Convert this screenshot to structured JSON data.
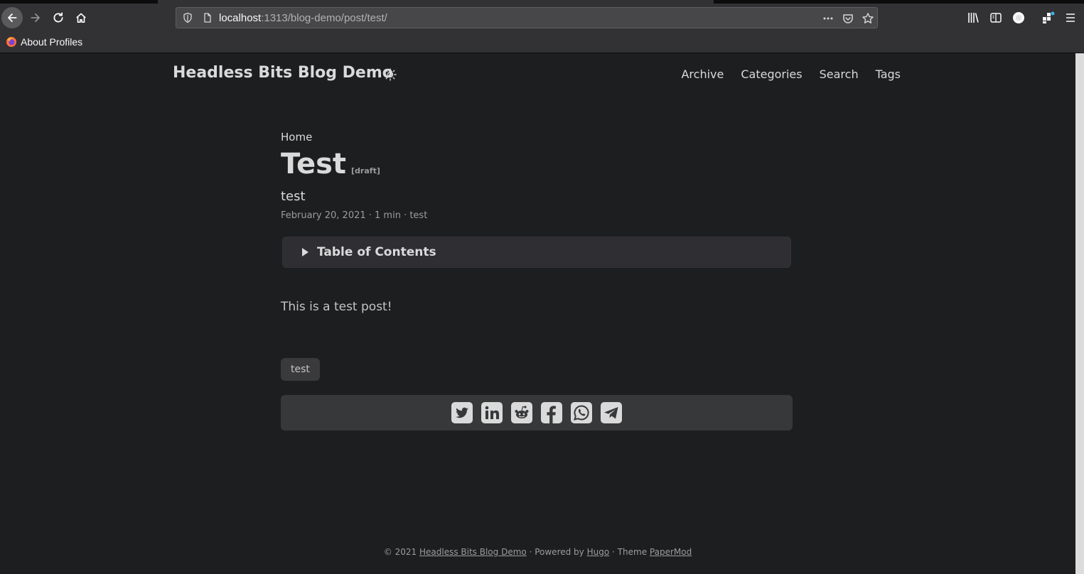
{
  "browser": {
    "url_host": "localhost",
    "url_rest": ":1313/blog-demo/post/test/",
    "bookmarks": [
      {
        "label": "About Profiles",
        "icon": "firefox-icon"
      }
    ]
  },
  "site": {
    "logo": "Headless Bits Blog Demo",
    "menu": [
      "Archive",
      "Categories",
      "Search",
      "Tags"
    ]
  },
  "post": {
    "breadcrumb": "Home",
    "title": "Test",
    "draft_label": "[draft]",
    "description": "test",
    "meta": "February 20, 2021 · 1 min · test",
    "toc_label": "Table of Contents",
    "content": "This is a test post!",
    "tags": [
      "test"
    ],
    "share_icons": [
      "twitter-icon",
      "linkedin-icon",
      "reddit-icon",
      "facebook-icon",
      "whatsapp-icon",
      "telegram-icon"
    ]
  },
  "footer": {
    "copyright": "© 2021",
    "site_link": "Headless Bits Blog Demo",
    "sep1": "·",
    "powered_by": "Powered by",
    "hugo_link": "Hugo",
    "sep2": "·",
    "theme": "Theme",
    "theme_link": "PaperMod"
  },
  "colors": {
    "page_bg": "#1d1e20",
    "chrome_bg": "#323234",
    "text": "#dadadb",
    "secondary": "#9b9c9d",
    "tag_bg": "#3a3a3c",
    "share_bg": "#37383a"
  }
}
